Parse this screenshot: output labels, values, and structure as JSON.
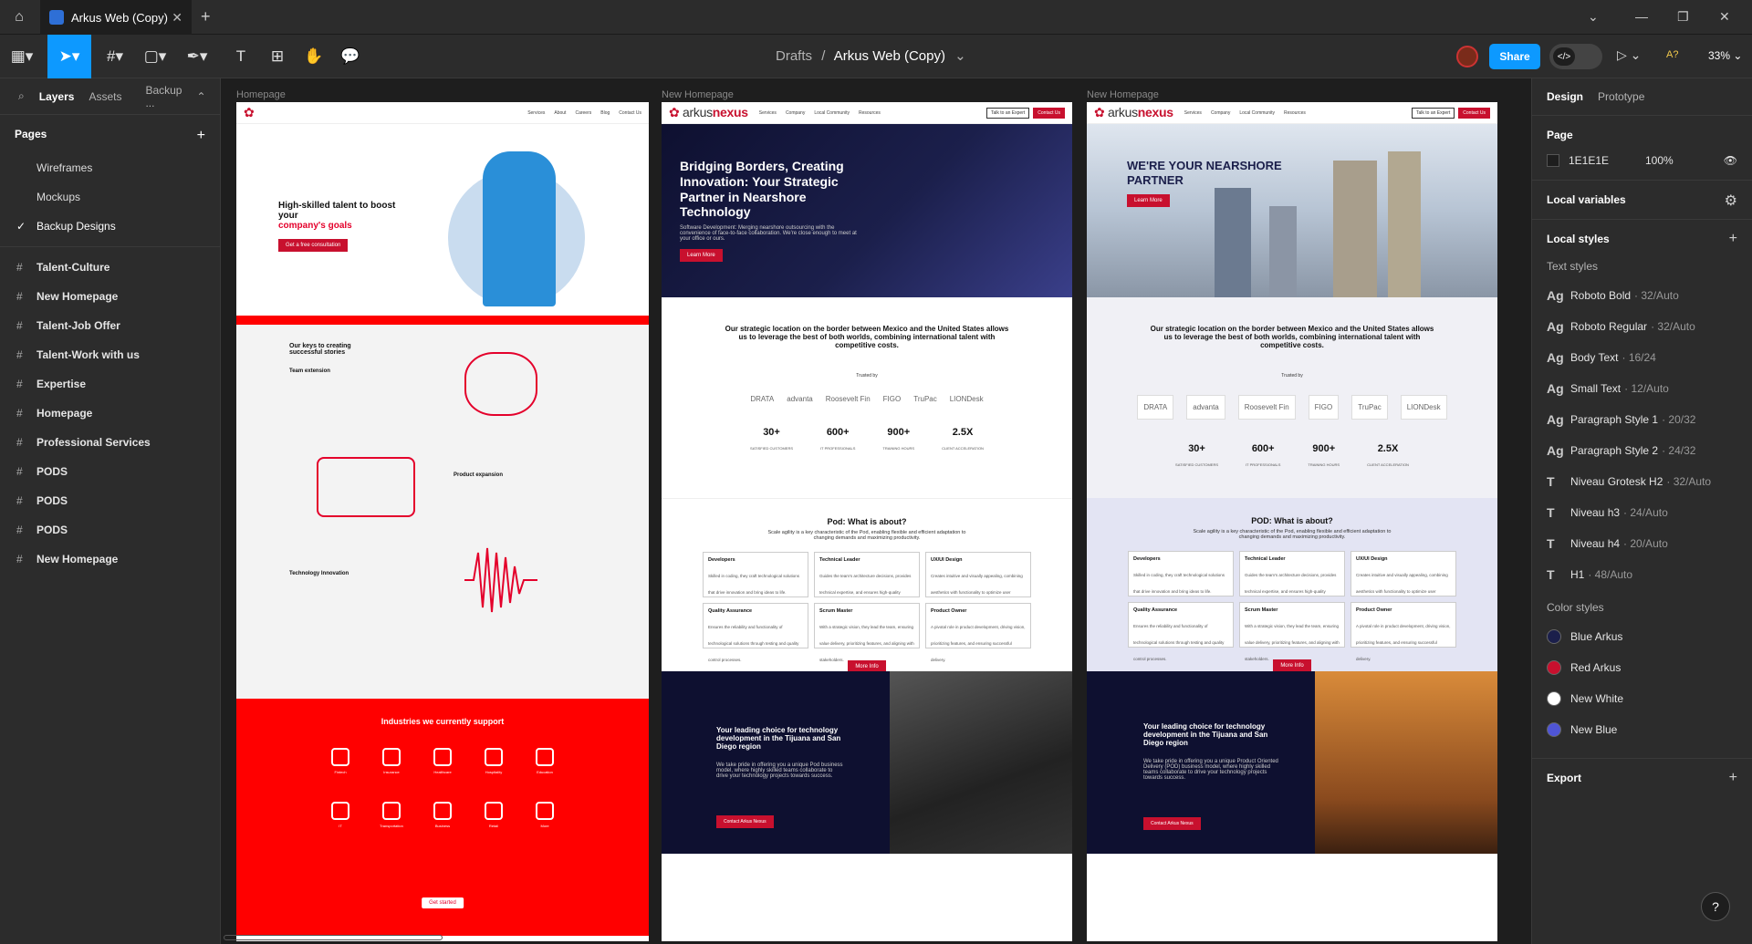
{
  "tabbar": {
    "tab_title": "Arkus Web (Copy)",
    "close": "✕",
    "new_tab": "+"
  },
  "toolbar": {
    "crumb_parent": "Drafts",
    "crumb_sep": "/",
    "file_name": "Arkus Web (Copy)",
    "share_label": "Share",
    "zoom": "33%",
    "aq": "A?"
  },
  "left": {
    "tabs": [
      "Layers",
      "Assets",
      "Backup ..."
    ],
    "pages_title": "Pages",
    "pages": [
      "Wireframes",
      "Mockups",
      "Backup Designs"
    ],
    "layers": [
      "Talent-Culture",
      "New Homepage",
      "Talent-Job Offer",
      "Talent-Work with us",
      "Expertise",
      "Homepage",
      "Professional Services",
      "PODS",
      "PODS",
      "PODS",
      "New Homepage"
    ]
  },
  "right": {
    "tabs": [
      "Design",
      "Prototype"
    ],
    "page_title": "Page",
    "page_color": "1E1E1E",
    "page_opacity": "100%",
    "local_variables": "Local variables",
    "local_styles": "Local styles",
    "text_styles_title": "Text styles",
    "text_styles": [
      {
        "name": "Roboto Bold",
        "meta": "· 32/Auto",
        "icon": "Ag"
      },
      {
        "name": "Roboto Regular",
        "meta": "· 32/Auto",
        "icon": "Ag"
      },
      {
        "name": "Body Text",
        "meta": "· 16/24",
        "icon": "Ag"
      },
      {
        "name": "Small Text",
        "meta": "· 12/Auto",
        "icon": "Ag"
      },
      {
        "name": "Paragraph Style 1",
        "meta": "· 20/32",
        "icon": "Ag"
      },
      {
        "name": "Paragraph Style 2",
        "meta": "· 24/32",
        "icon": "Ag"
      },
      {
        "name": "Niveau Grotesk H2",
        "meta": "· 32/Auto",
        "icon": "T"
      },
      {
        "name": "Niveau h3",
        "meta": "· 24/Auto",
        "icon": "T"
      },
      {
        "name": "Niveau h4",
        "meta": "· 20/Auto",
        "icon": "T"
      },
      {
        "name": "H1",
        "meta": "· 48/Auto",
        "icon": "T"
      }
    ],
    "color_styles_title": "Color styles",
    "color_styles": [
      {
        "name": "Blue Arkus",
        "color": "#1b1f4b"
      },
      {
        "name": "Red Arkus",
        "color": "#c8102e"
      },
      {
        "name": "New White",
        "color": "#ffffff"
      },
      {
        "name": "New Blue",
        "color": "#4f55d6"
      }
    ],
    "export": "Export"
  },
  "canvas": {
    "frame_labels": [
      "Homepage",
      "New Homepage",
      "New Homepage"
    ],
    "f1": {
      "nav_links": [
        "Services",
        "About",
        "Careers",
        "Blog",
        "Contact Us"
      ],
      "hero_title": "High-skilled talent to boost your",
      "hero_title_red": "company's goals",
      "hero_btn": "Get a free consultation",
      "keys_title": "Our keys to creating successful stories",
      "team_ext": "Team extension",
      "product_exp": "Product expansion",
      "tech_innov": "Technology Innovation",
      "industries_title": "Industries we currently support",
      "industries": [
        "Fintech",
        "Insurance",
        "Healthcare",
        "Hospitality",
        "Education",
        "IT",
        "Transportation",
        "Business",
        "Retail",
        "More"
      ],
      "get_started": "Get started"
    },
    "f2": {
      "nav_links": [
        "Services",
        "Company",
        "Local Community",
        "Resources"
      ],
      "btn_expert": "Talk to an Expert",
      "btn_contact": "Contact Us",
      "hero_title": "Bridging Borders, Creating Innovation: Your Strategic Partner in Nearshore Technology",
      "hero_sub": "Software Development: Merging nearshore outsourcing with the convenience of face-to-face collaboration. We're close enough to meet at your office or ours.",
      "learn_more": "Learn More",
      "strategic": "Our strategic location on the border between Mexico and the United States allows us to leverage the best of both worlds, combining international talent with competitive costs.",
      "trusted": "Trusted by",
      "logos": [
        "DRATA",
        "advanta",
        "Roosevelt Fin",
        "FIGO",
        "TruPac",
        "LIONDesk"
      ],
      "stats": [
        {
          "v": "30+",
          "l": "SATISFIED CUSTOMERS"
        },
        {
          "v": "600+",
          "l": "IT PROFESSIONALS"
        },
        {
          "v": "900+",
          "l": "TRAINING HOURS"
        },
        {
          "v": "2.5X",
          "l": "CLIENT ACCELERATION"
        }
      ],
      "pod_title": "Pod: What is about?",
      "pod_sub": "Scale agility is a key characteristic of the Pod, enabling flexible and efficient adaptation to changing demands and maximizing productivity.",
      "cards": [
        {
          "t": "Developers",
          "d": "Skilled in coding, they craft technological solutions that drive innovation and bring ideas to life."
        },
        {
          "t": "Technical Leader",
          "d": "Guides the team's architecture decisions, provides technical expertise, and ensures high-quality development practices."
        },
        {
          "t": "UX/UI Design",
          "d": "Creates intuitive and visually appealing, combining aesthetics with functionality to optimize user satisfaction."
        },
        {
          "t": "Quality Assurance",
          "d": "Ensures the reliability and functionality of technological solutions through testing and quality control processes."
        },
        {
          "t": "Scrum Master",
          "d": "With a strategic vision, they lead the team, ensuring value delivery, prioritizing features, and aligning with stakeholders."
        },
        {
          "t": "Product Owner",
          "d": "A pivotal role in product development, driving vision, prioritizing features, and ensuring successful delivery."
        }
      ],
      "more_info": "More Info",
      "lead_title": "Your leading choice for technology development in the Tijuana and San Diego region",
      "lead_sub": "We take pride in offering you a unique Pod business model, where highly skilled teams collaborate to drive your technology projects towards success.",
      "contact_nexus": "Contact Arkus Nexus"
    },
    "f3": {
      "hero_title": "WE'RE YOUR NEARSHORE PARTNER",
      "learn_more": "Learn More",
      "pod_title": "POD: What is about?",
      "more_info": "More Info",
      "lead_title": "Your leading choice for technology development in the Tijuana and San Diego region",
      "lead_sub": "We take pride in offering you a unique Product Oriented Delivery (POD) business model, where highly skilled teams collaborate to drive your technology projects towards success.",
      "contact_nexus": "Contact Arkus Nexus"
    }
  }
}
